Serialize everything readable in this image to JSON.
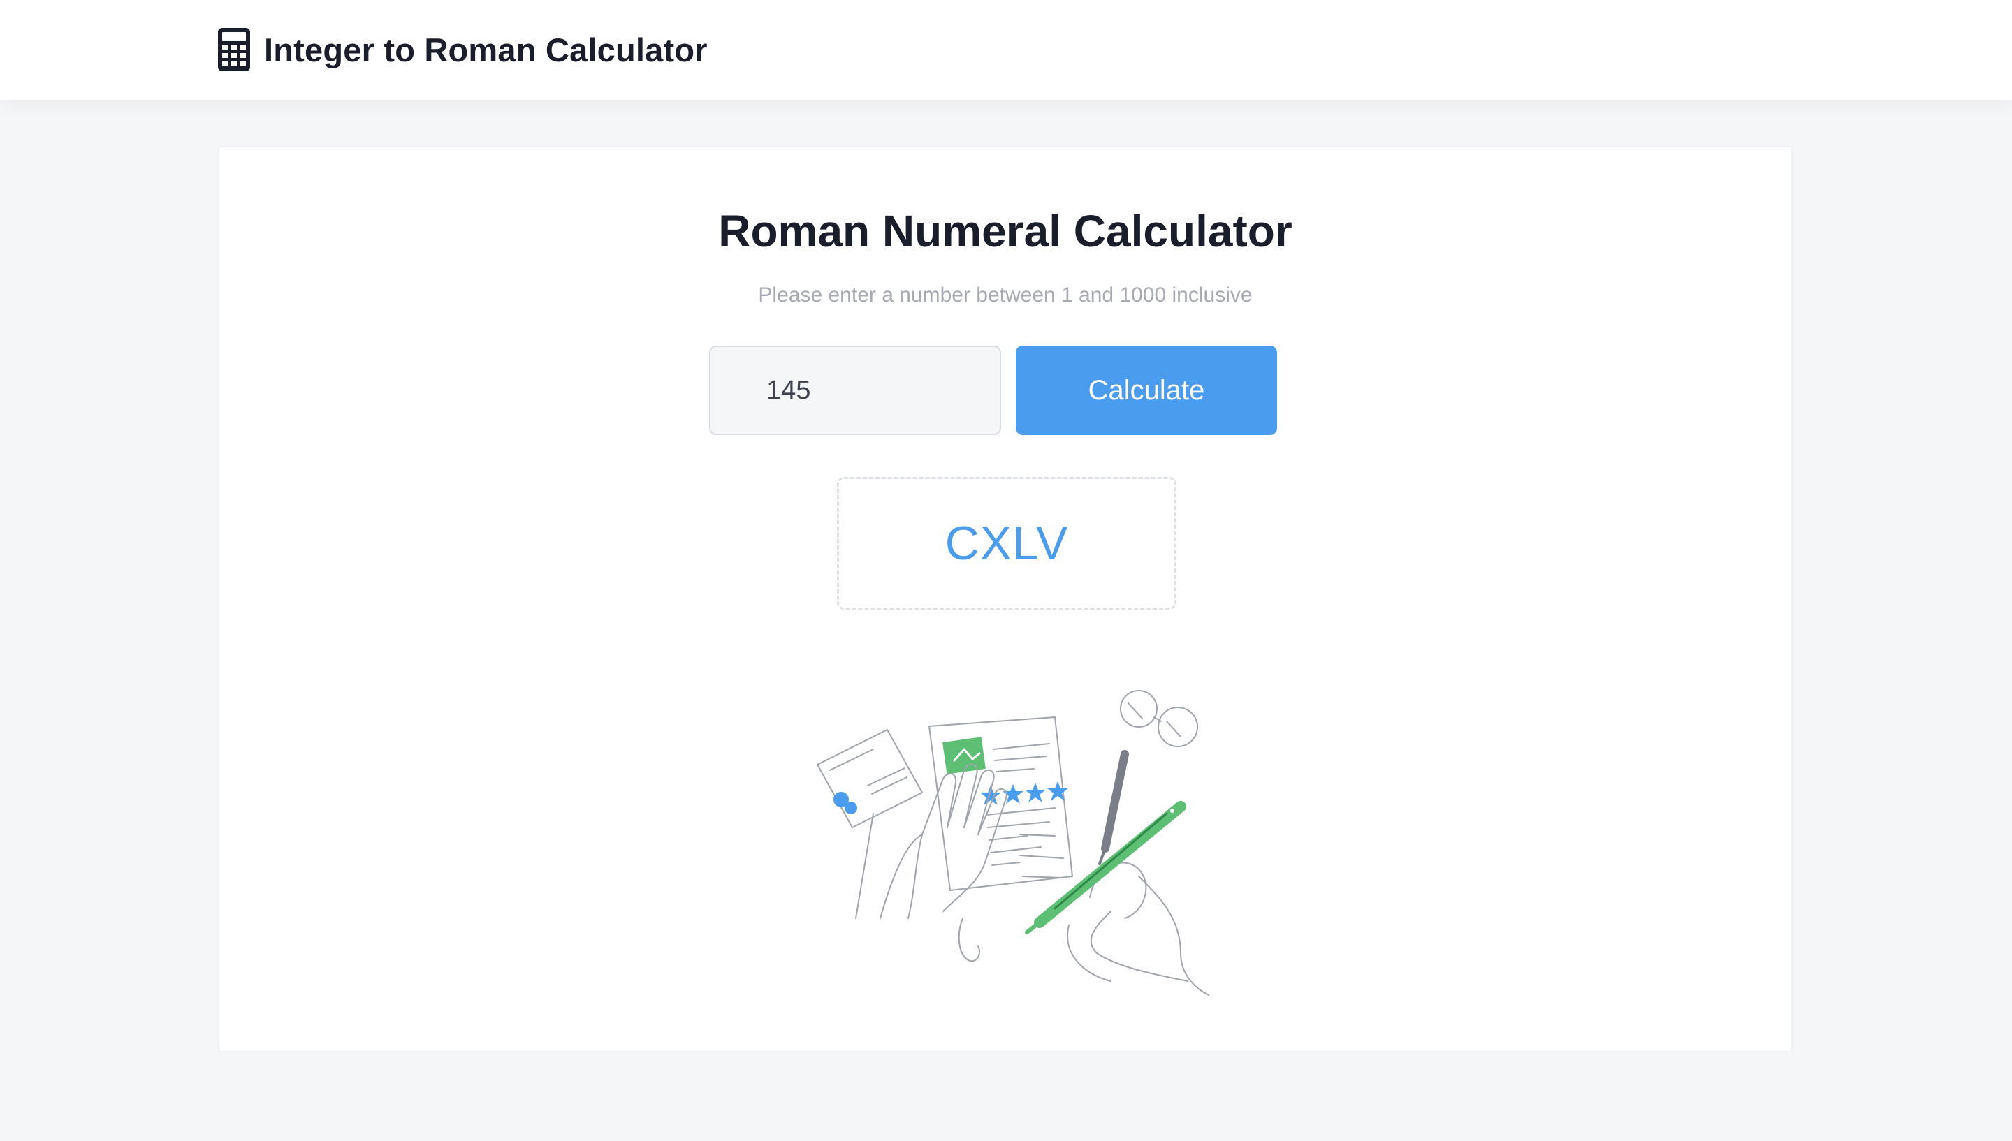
{
  "header": {
    "title": "Integer to Roman Calculator",
    "icon": "calculator-icon"
  },
  "main": {
    "title": "Roman Numeral Calculator",
    "hint": "Please enter a number between 1 and 1000 inclusive",
    "input": {
      "value": "145",
      "placeholder": ""
    },
    "button_label": "Calculate",
    "result": "CXLV",
    "illustration": "document-review-illustration"
  },
  "colors": {
    "accent": "#4a9cee",
    "illustration_green": "#5cbf74",
    "page_background": "#f5f6f8",
    "text_dark": "#1a1d2b",
    "hint_text": "#a7aab4"
  }
}
